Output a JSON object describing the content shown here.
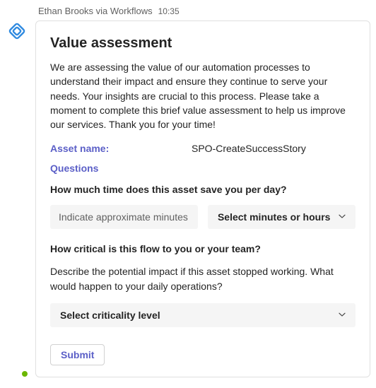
{
  "header": {
    "sender": "Ethan Brooks via Workflows",
    "timestamp": "10:35"
  },
  "card": {
    "title": "Value assessment",
    "description": "We are assessing the value of our automation processes to understand their impact and ensure they continue to serve your needs. Your insights are crucial to this process. Please take a moment to complete this brief value assessment to help us improve our services. Thank you for your time!",
    "asset_name_label": "Asset name:",
    "asset_name_value": "SPO-CreateSuccessStory",
    "questions_label": "Questions",
    "q1": {
      "text": "How much time does this asset save you per day?",
      "input_placeholder": "Indicate approximate minutes",
      "select_placeholder": "Select minutes or hours"
    },
    "q2": {
      "text": "How critical is this flow to you or your team?",
      "subtext": "Describe the potential impact if this asset stopped working. What would happen to your daily operations?",
      "select_placeholder": "Select criticality level"
    },
    "submit_label": "Submit"
  }
}
